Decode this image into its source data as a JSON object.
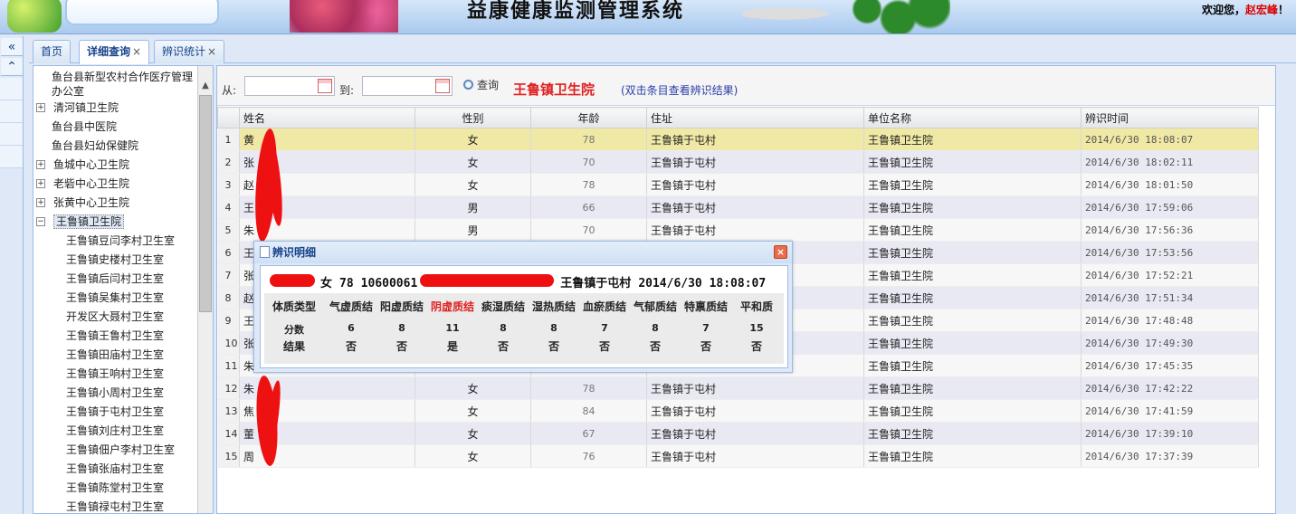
{
  "header": {
    "app_title": "益康健康监测管理系统",
    "welcome_prefix": "欢迎您，",
    "welcome_user": "赵宏峰",
    "welcome_suffix": "！"
  },
  "left_strip": {
    "collapse_glyph": "«",
    "expand_glyph": "⌃"
  },
  "tabs": [
    {
      "label": "首页",
      "closable": false,
      "active": false
    },
    {
      "label": "详细查询",
      "closable": true,
      "active": true
    },
    {
      "label": "辨识统计",
      "closable": true,
      "active": false
    }
  ],
  "tab_close_glyph": "×",
  "tree": {
    "items": [
      {
        "label": "鱼台县新型农村合作医疗管理办公室",
        "level": 0,
        "expander": ""
      },
      {
        "label": "清河镇卫生院",
        "level": 0,
        "expander": "+"
      },
      {
        "label": "鱼台县中医院",
        "level": 0,
        "expander": ""
      },
      {
        "label": "鱼台县妇幼保健院",
        "level": 0,
        "expander": ""
      },
      {
        "label": "鱼城中心卫生院",
        "level": 0,
        "expander": "+"
      },
      {
        "label": "老砦中心卫生院",
        "level": 0,
        "expander": "+"
      },
      {
        "label": "张黄中心卫生院",
        "level": 0,
        "expander": "+"
      },
      {
        "label": "王鲁镇卫生院",
        "level": 0,
        "expander": "−",
        "selected": true
      },
      {
        "label": "王鲁镇豆闫李村卫生室",
        "level": 1
      },
      {
        "label": "王鲁镇史楼村卫生室",
        "level": 1
      },
      {
        "label": "王鲁镇后闫村卫生室",
        "level": 1
      },
      {
        "label": "王鲁镇吴集村卫生室",
        "level": 1
      },
      {
        "label": "开发区大聂村卫生室",
        "level": 1
      },
      {
        "label": "王鲁镇王鲁村卫生室",
        "level": 1
      },
      {
        "label": "王鲁镇田庙村卫生室",
        "level": 1
      },
      {
        "label": "王鲁镇王响村卫生室",
        "level": 1
      },
      {
        "label": "王鲁镇小周村卫生室",
        "level": 1
      },
      {
        "label": "王鲁镇于屯村卫生室",
        "level": 1
      },
      {
        "label": "王鲁镇刘庄村卫生室",
        "level": 1
      },
      {
        "label": "王鲁镇佃户李村卫生室",
        "level": 1
      },
      {
        "label": "王鲁镇张庙村卫生室",
        "level": 1
      },
      {
        "label": "王鲁镇陈堂村卫生室",
        "level": 1
      },
      {
        "label": "王鲁镇禄屯村卫生室",
        "level": 1
      }
    ],
    "scroll_up_glyph": "▲"
  },
  "filter": {
    "from_label": "从:",
    "from_value": "",
    "to_label": "到:",
    "to_value": "",
    "query_label": "查询",
    "hospital": "王鲁镇卫生院",
    "hint": "(双击条目查看辨识结果)"
  },
  "grid": {
    "columns": [
      "姓名",
      "性别",
      "年龄",
      "住址",
      "单位名称",
      "辨识时间"
    ],
    "rows": [
      {
        "n": "1",
        "name": "黄",
        "sex": "女",
        "age": "78",
        "addr": "王鲁镇于屯村",
        "unit": "王鲁镇卫生院",
        "time": "2014/6/30 18:08:07"
      },
      {
        "n": "2",
        "name": "张",
        "sex": "女",
        "age": "70",
        "addr": "王鲁镇于屯村",
        "unit": "王鲁镇卫生院",
        "time": "2014/6/30 18:02:11"
      },
      {
        "n": "3",
        "name": "赵",
        "sex": "女",
        "age": "78",
        "addr": "王鲁镇于屯村",
        "unit": "王鲁镇卫生院",
        "time": "2014/6/30 18:01:50"
      },
      {
        "n": "4",
        "name": "王",
        "sex": "男",
        "age": "66",
        "addr": "王鲁镇于屯村",
        "unit": "王鲁镇卫生院",
        "time": "2014/6/30 17:59:06"
      },
      {
        "n": "5",
        "name": "朱",
        "sex": "男",
        "age": "70",
        "addr": "王鲁镇于屯村",
        "unit": "王鲁镇卫生院",
        "time": "2014/6/30 17:56:36"
      },
      {
        "n": "6",
        "name": "王",
        "sex": "",
        "age": "",
        "addr": "",
        "unit": "王鲁镇卫生院",
        "time": "2014/6/30 17:53:56"
      },
      {
        "n": "7",
        "name": "张",
        "sex": "",
        "age": "",
        "addr": "",
        "unit": "王鲁镇卫生院",
        "time": "2014/6/30 17:52:21"
      },
      {
        "n": "8",
        "name": "赵",
        "sex": "",
        "age": "",
        "addr": "",
        "unit": "王鲁镇卫生院",
        "time": "2014/6/30 17:51:34"
      },
      {
        "n": "9",
        "name": "王",
        "sex": "",
        "age": "",
        "addr": "",
        "unit": "王鲁镇卫生院",
        "time": "2014/6/30 17:48:48"
      },
      {
        "n": "10",
        "name": "张",
        "sex": "",
        "age": "",
        "addr": "",
        "unit": "王鲁镇卫生院",
        "time": "2014/6/30 17:49:30"
      },
      {
        "n": "11",
        "name": "朱",
        "sex": "",
        "age": "",
        "addr": "",
        "unit": "王鲁镇卫生院",
        "time": "2014/6/30 17:45:35"
      },
      {
        "n": "12",
        "name": "朱",
        "sex": "女",
        "age": "78",
        "addr": "王鲁镇于屯村",
        "unit": "王鲁镇卫生院",
        "time": "2014/6/30 17:42:22"
      },
      {
        "n": "13",
        "name": "焦",
        "sex": "女",
        "age": "84",
        "addr": "王鲁镇于屯村",
        "unit": "王鲁镇卫生院",
        "time": "2014/6/30 17:41:59"
      },
      {
        "n": "14",
        "name": "董",
        "sex": "女",
        "age": "67",
        "addr": "王鲁镇于屯村",
        "unit": "王鲁镇卫生院",
        "time": "2014/6/30 17:39:10"
      },
      {
        "n": "15",
        "name": "周",
        "sex": "女",
        "age": "76",
        "addr": "王鲁镇于屯村",
        "unit": "王鲁镇卫生院",
        "time": "2014/6/30 17:37:39"
      }
    ]
  },
  "dialog": {
    "title": "辨识明细",
    "close_glyph": "×",
    "info": {
      "sex": "女",
      "age": "78",
      "id": "10600061",
      "address": "王鲁镇于屯村",
      "time": "2014/6/30 18:08:07"
    },
    "row_labels": [
      "体质类型",
      "分数",
      "结果"
    ],
    "types": [
      "气虚质结",
      "阳虚质结",
      "阴虚质结",
      "痰湿质结",
      "湿热质结",
      "血瘀质结",
      "气郁质结",
      "特禀质结",
      "平和质"
    ],
    "scores": [
      "6",
      "8",
      "11",
      "8",
      "8",
      "7",
      "8",
      "7",
      "15"
    ],
    "results": [
      "否",
      "否",
      "是",
      "否",
      "否",
      "否",
      "否",
      "否",
      "否"
    ],
    "highlight_color": "#e02020",
    "highlight_index": 2
  },
  "colors": {
    "accent": "#15428b",
    "alert": "#e02020",
    "selected_row": "#f0e9a6"
  }
}
